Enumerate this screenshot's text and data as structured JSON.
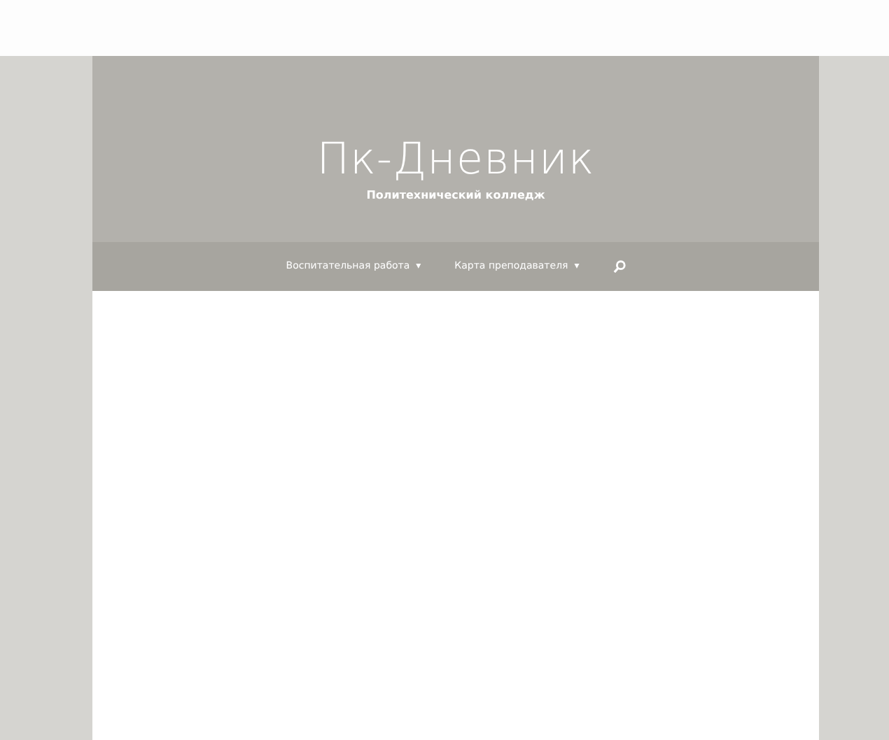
{
  "site": {
    "title": "Пк-Дневник",
    "subtitle": "Политехнический колледж"
  },
  "menu": [
    {
      "label": "Воспитательная работа",
      "caret": "▾"
    },
    {
      "label": "Карта преподавателя",
      "caret": "▾"
    }
  ]
}
